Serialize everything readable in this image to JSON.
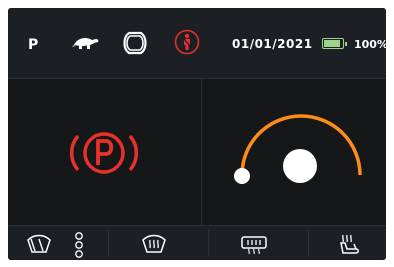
{
  "status_bar": {
    "gear": "P",
    "icons": [
      "turtle-icon",
      "tire-pressure-icon",
      "seatbelt-icon"
    ],
    "date": "01/01/2021",
    "battery_percent_label": "100%",
    "battery_level": 1.0
  },
  "main": {
    "left_panel_icon": "parking-brake-icon",
    "right_panel_icon": "speed-arc-gauge"
  },
  "bottom_bar": {
    "buttons": [
      "front-wiper-icon",
      "wiper-mode-selector",
      "windshield-defrost-icon",
      "rear-defrost-icon",
      "seat-heater-icon"
    ]
  },
  "colors": {
    "warning_red": "#e8312a",
    "gauge_orange": "#ff8c1a",
    "battery_green": "#9bd48a",
    "icon_white": "#ffffff"
  }
}
